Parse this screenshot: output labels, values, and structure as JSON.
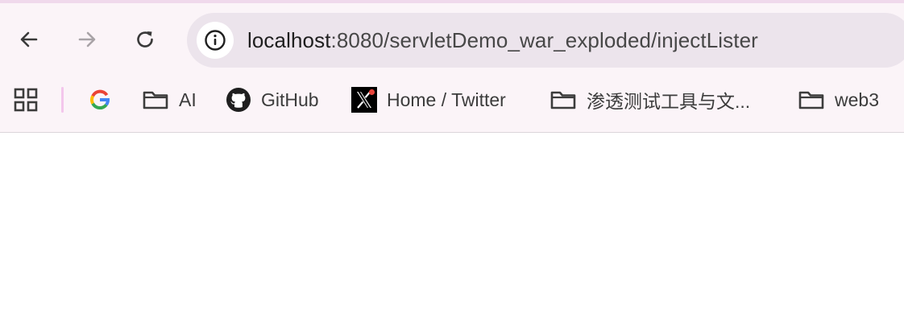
{
  "browser": {
    "address_bar": {
      "host": "localhost",
      "path": ":8080/servletDemo_war_exploded/injectLister"
    },
    "nav": {
      "back_icon": "arrow-left-icon",
      "forward_icon": "arrow-right-icon",
      "reload_icon": "reload-icon",
      "site_info_icon": "info-icon"
    }
  },
  "bookmarks_bar": {
    "apps_icon": "apps-grid-icon",
    "items": [
      {
        "label": "",
        "icon": "google-icon"
      },
      {
        "label": "AI",
        "icon": "folder-icon"
      },
      {
        "label": "GitHub",
        "icon": "github-icon"
      },
      {
        "label": "Home / Twitter",
        "icon": "x-twitter-icon"
      },
      {
        "label": "渗透测试工具与文...",
        "icon": "folder-icon"
      },
      {
        "label": "web3",
        "icon": "folder-icon"
      }
    ]
  },
  "colors": {
    "chrome_bg": "#fbf4f8",
    "omnibox_bg": "#ece4ec",
    "page_bg": "#ffffff",
    "separator": "#f3c6ec"
  }
}
